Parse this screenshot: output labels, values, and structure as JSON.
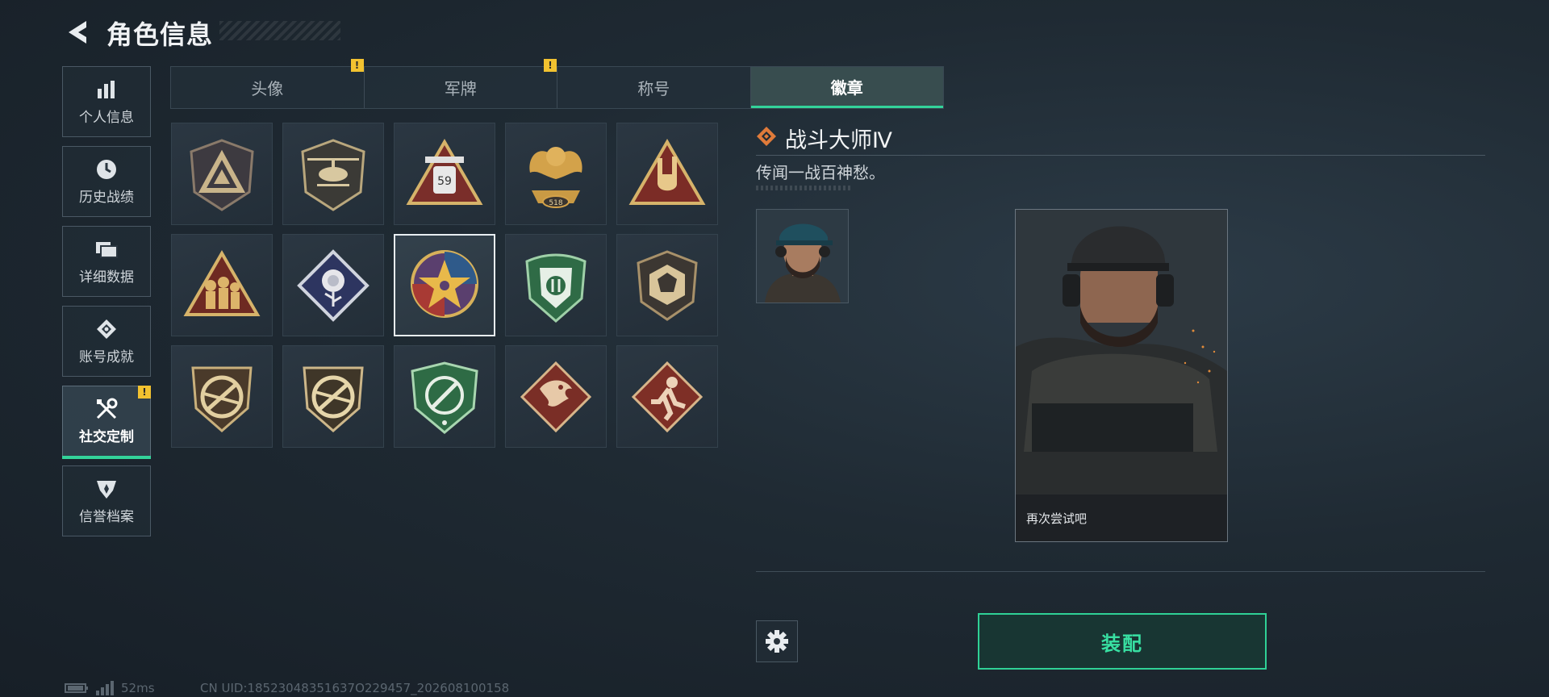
{
  "header": {
    "title": "角色信息",
    "back_icon": "chevron-left-icon"
  },
  "sidebar": {
    "items": [
      {
        "label": "个人信息",
        "icon": "bar-chart-icon",
        "active": false,
        "alert": false
      },
      {
        "label": "历史战绩",
        "icon": "clock-icon",
        "active": false,
        "alert": false
      },
      {
        "label": "详细数据",
        "icon": "folder-icon",
        "active": false,
        "alert": false
      },
      {
        "label": "账号成就",
        "icon": "medal-icon",
        "active": false,
        "alert": false
      },
      {
        "label": "社交定制",
        "icon": "tools-icon",
        "active": true,
        "alert": true
      },
      {
        "label": "信誉档案",
        "icon": "shield-icon",
        "active": false,
        "alert": false
      }
    ]
  },
  "tabs": [
    {
      "label": "头像",
      "active": false,
      "alert": true
    },
    {
      "label": "军牌",
      "active": false,
      "alert": true
    },
    {
      "label": "称号",
      "active": false,
      "alert": false
    },
    {
      "label": "徽章",
      "active": true,
      "alert": false
    }
  ],
  "alert_glyph": "!",
  "badges": [
    {
      "icon": "triangle-emblem-badge-icon"
    },
    {
      "icon": "helicopter-badge-icon"
    },
    {
      "icon": "medic-59-badge-icon",
      "text": "59"
    },
    {
      "icon": "phoenix-skull-badge-icon",
      "text": "518"
    },
    {
      "icon": "hand-sign-badge-icon"
    },
    {
      "icon": "soldiers-badge-icon"
    },
    {
      "icon": "rose-badge-icon"
    },
    {
      "icon": "star-medal-badge-icon",
      "selected": true
    },
    {
      "icon": "green-crest-badge-icon"
    },
    {
      "icon": "dice-badge-icon"
    },
    {
      "icon": "no-rifle-badge-icon"
    },
    {
      "icon": "no-rifle-2-badge-icon"
    },
    {
      "icon": "crosshair-knife-badge-icon"
    },
    {
      "icon": "dragon-badge-icon"
    },
    {
      "icon": "runner-badge-icon"
    }
  ],
  "detail": {
    "title": "战斗大师Ⅳ",
    "description": "传闻一战百神愁。",
    "portrait_caption": "再次尝试吧",
    "equip_label": "装配"
  },
  "status": {
    "ping": "52ms",
    "uid": "CN UID:18523048351637O229457_202608100158"
  },
  "colors": {
    "accent": "#33d39a",
    "alert": "#f2c230",
    "background": "#1f2a33"
  }
}
